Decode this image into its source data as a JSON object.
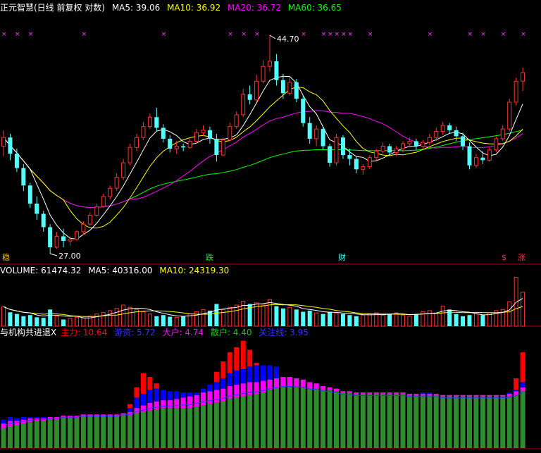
{
  "colors": {
    "background": "#000000",
    "up": "#ff3232",
    "down": "#54ffff",
    "ma5": "#ffffff",
    "ma10": "#ffff00",
    "ma20": "#ff00ff",
    "ma60": "#00ff00",
    "frame": "#b00000",
    "main_force": "#ff0000",
    "private_equity": "#0000ff",
    "big_holder": "#ff00ff",
    "retail": "#2e8b2e",
    "key_line": "#3333ff"
  },
  "price_panel": {
    "title": "正元智慧(日线 前复权 对数)",
    "ma5_label": "MA5: 39.06",
    "ma10_label": "MA10: 36.92",
    "ma20_label": "MA20: 36.72",
    "ma60_label": "MA60: 36.65",
    "high_label": "44.70",
    "low_label": "27.00",
    "signal_labels": [
      "稳",
      "跌",
      "财",
      "$",
      "涨"
    ]
  },
  "volume_panel": {
    "volume_label": "VOLUME: 61474.32",
    "ma5_label": "MA5: 40316.00",
    "ma10_label": "MA10: 24319.30"
  },
  "indicator_panel": {
    "title": "与机构共进退X",
    "main_force_label": "主力: 10.64",
    "private_equity_label": "游资: 5.72",
    "big_holder_label": "大户: 4.74",
    "retail_label": "散户: 4.40",
    "key_line_label": "关注线: 3.95"
  },
  "chart_data": {
    "type": "candlestick",
    "price_scale": "log",
    "price_range": [
      27.0,
      44.7
    ],
    "candles": [
      [
        34.6,
        35.9,
        33.8,
        35.3
      ],
      [
        35.3,
        35.6,
        33.5,
        34.0
      ],
      [
        34.0,
        34.4,
        32.6,
        32.9
      ],
      [
        32.9,
        33.2,
        31.2,
        31.6
      ],
      [
        31.6,
        31.8,
        30.0,
        30.3
      ],
      [
        30.3,
        30.8,
        29.2,
        29.6
      ],
      [
        29.6,
        29.8,
        28.4,
        28.7
      ],
      [
        28.7,
        28.9,
        27.0,
        27.4
      ],
      [
        27.4,
        28.4,
        27.3,
        28.1
      ],
      [
        28.1,
        28.6,
        27.4,
        27.8
      ],
      [
        27.8,
        28.1,
        27.5,
        27.9
      ],
      [
        27.9,
        28.5,
        27.8,
        28.4
      ],
      [
        28.4,
        29.1,
        28.2,
        28.9
      ],
      [
        28.9,
        29.7,
        28.8,
        29.5
      ],
      [
        29.5,
        30.3,
        29.4,
        30.1
      ],
      [
        30.1,
        31.0,
        30.0,
        30.8
      ],
      [
        30.8,
        31.6,
        30.6,
        31.4
      ],
      [
        31.4,
        32.5,
        31.2,
        32.2
      ],
      [
        32.2,
        33.6,
        32.0,
        33.3
      ],
      [
        33.3,
        34.8,
        33.1,
        34.5
      ],
      [
        34.5,
        35.6,
        34.2,
        35.3
      ],
      [
        35.3,
        36.6,
        35.1,
        36.2
      ],
      [
        36.2,
        37.3,
        36.0,
        37.0
      ],
      [
        37.0,
        37.8,
        35.8,
        36.1
      ],
      [
        36.1,
        36.4,
        34.9,
        35.2
      ],
      [
        35.2,
        35.5,
        34.1,
        34.4
      ],
      [
        34.4,
        35.0,
        34.0,
        34.6
      ],
      [
        34.6,
        34.8,
        34.2,
        34.5
      ],
      [
        34.5,
        35.2,
        34.4,
        35.0
      ],
      [
        35.0,
        36.0,
        34.8,
        35.7
      ],
      [
        35.7,
        36.3,
        35.4,
        35.9
      ],
      [
        35.9,
        36.2,
        34.8,
        35.2
      ],
      [
        35.2,
        35.6,
        33.4,
        33.9
      ],
      [
        33.9,
        35.3,
        33.8,
        35.1
      ],
      [
        35.1,
        36.5,
        35.0,
        36.2
      ],
      [
        36.2,
        37.5,
        36.0,
        37.2
      ],
      [
        37.2,
        39.5,
        37.0,
        39.0
      ],
      [
        39.0,
        39.8,
        38.1,
        38.5
      ],
      [
        38.5,
        40.8,
        38.3,
        40.2
      ],
      [
        40.2,
        42.2,
        40.0,
        41.6
      ],
      [
        41.6,
        44.7,
        41.1,
        42.1
      ],
      [
        42.1,
        42.8,
        39.8,
        40.3
      ],
      [
        40.3,
        40.9,
        38.6,
        39.1
      ],
      [
        39.1,
        40.6,
        38.9,
        40.1
      ],
      [
        40.1,
        40.4,
        38.3,
        38.6
      ],
      [
        38.6,
        38.9,
        36.2,
        36.5
      ],
      [
        36.5,
        37.0,
        34.8,
        35.2
      ],
      [
        35.2,
        36.3,
        34.6,
        36.0
      ],
      [
        36.0,
        36.2,
        34.3,
        34.6
      ],
      [
        34.6,
        34.8,
        33.0,
        33.3
      ],
      [
        33.3,
        35.6,
        33.1,
        35.3
      ],
      [
        35.3,
        35.5,
        33.6,
        33.9
      ],
      [
        33.9,
        34.4,
        33.1,
        33.6
      ],
      [
        33.6,
        33.8,
        32.5,
        32.8
      ],
      [
        32.8,
        33.2,
        32.4,
        33.0
      ],
      [
        33.0,
        33.9,
        32.8,
        33.7
      ],
      [
        33.7,
        34.4,
        33.5,
        34.2
      ],
      [
        34.2,
        34.9,
        34.0,
        34.6
      ],
      [
        34.6,
        34.8,
        33.9,
        34.1
      ],
      [
        34.1,
        34.6,
        33.8,
        34.4
      ],
      [
        34.4,
        35.0,
        34.1,
        34.8
      ],
      [
        34.8,
        35.3,
        34.5,
        35.0
      ],
      [
        35.0,
        35.2,
        34.3,
        34.6
      ],
      [
        34.6,
        35.1,
        34.4,
        34.9
      ],
      [
        34.9,
        35.6,
        34.7,
        35.3
      ],
      [
        35.3,
        36.1,
        35.0,
        35.8
      ],
      [
        35.8,
        36.6,
        35.5,
        36.3
      ],
      [
        36.3,
        36.5,
        35.6,
        35.9
      ],
      [
        35.9,
        36.2,
        35.0,
        35.4
      ],
      [
        35.4,
        35.7,
        34.3,
        34.6
      ],
      [
        34.6,
        34.9,
        32.8,
        33.1
      ],
      [
        33.1,
        34.0,
        32.9,
        33.7
      ],
      [
        33.7,
        34.2,
        33.2,
        33.5
      ],
      [
        33.5,
        34.5,
        33.4,
        34.3
      ],
      [
        34.3,
        35.4,
        34.1,
        35.2
      ],
      [
        35.2,
        36.3,
        35.0,
        36.0
      ],
      [
        36.0,
        38.6,
        35.8,
        38.3
      ],
      [
        38.3,
        40.5,
        38.0,
        40.2
      ],
      [
        40.2,
        41.5,
        39.3,
        41.0
      ]
    ],
    "volume": [
      35,
      25,
      22,
      18,
      20,
      16,
      15,
      30,
      18,
      12,
      14,
      16,
      15,
      18,
      22,
      25,
      28,
      32,
      38,
      34,
      30,
      26,
      22,
      18,
      20,
      17,
      16,
      18,
      22,
      26,
      30,
      28,
      40,
      30,
      34,
      38,
      45,
      40,
      42,
      38,
      48,
      36,
      32,
      34,
      30,
      26,
      28,
      24,
      22,
      26,
      24,
      22,
      20,
      18,
      20,
      22,
      24,
      20,
      22,
      24,
      20,
      18,
      22,
      26,
      28,
      24,
      36,
      30,
      22,
      18,
      20,
      22,
      20,
      24,
      28,
      30,
      44,
      88,
      61
    ],
    "volume_ma5": "computed",
    "volume_ma10": "computed",
    "indicator_series": [
      "主力",
      "游资",
      "大户",
      "散户",
      "关注线"
    ],
    "indicator": {
      "retail": [
        1.5,
        1.7,
        1.8,
        1.9,
        2.0,
        2.1,
        2.1,
        2.2,
        2.2,
        2.3,
        2.3,
        2.3,
        2.4,
        2.4,
        2.4,
        2.4,
        2.4,
        2.4,
        2.5,
        2.5,
        2.7,
        2.8,
        2.9,
        3.0,
        3.1,
        3.1,
        3.1,
        3.1,
        3.1,
        3.2,
        3.3,
        3.4,
        3.5,
        3.6,
        3.8,
        3.9,
        4.0,
        4.1,
        4.2,
        4.3,
        4.5,
        4.6,
        4.7,
        4.7,
        4.7,
        4.7,
        4.6,
        4.6,
        4.5,
        4.5,
        4.4,
        4.3,
        4.3,
        4.2,
        4.2,
        4.2,
        4.2,
        4.2,
        4.2,
        4.2,
        4.2,
        4.1,
        4.1,
        4.1,
        4.1,
        4.1,
        4.0,
        4.0,
        4.0,
        4.0,
        4.0,
        4.0,
        4.0,
        4.0,
        4.0,
        4.0,
        4.0,
        4.1,
        4.4
      ],
      "big": [
        0.4,
        0.4,
        0.3,
        0.3,
        0.3,
        0.2,
        0.2,
        0.2,
        0.2,
        0.2,
        0.2,
        0.2,
        0.2,
        0.2,
        0.2,
        0.2,
        0.2,
        0.2,
        0.2,
        0.3,
        0.4,
        0.5,
        0.6,
        0.6,
        0.6,
        0.6,
        0.7,
        0.8,
        0.9,
        0.9,
        1.0,
        1.0,
        1.0,
        1.0,
        1.0,
        1.0,
        1.0,
        1.0,
        0.9,
        0.9,
        0.8,
        0.8,
        0.8,
        0.8,
        0.7,
        0.6,
        0.5,
        0.4,
        0.3,
        0.2,
        0.2,
        0.1,
        0.1,
        0.1,
        0.1,
        0.1,
        0.1,
        0.1,
        0.1,
        0.1,
        0.1,
        0.1,
        0.1,
        0.1,
        0.1,
        0.1,
        0.1,
        0.1,
        0.1,
        0.1,
        0.1,
        0.1,
        0.1,
        0.1,
        0.1,
        0.1,
        0.2,
        0.3,
        0.3
      ],
      "pe": [
        0.3,
        0.3,
        0.2,
        0.2,
        0.1,
        0.1,
        0.1,
        0.0,
        0.0,
        0.0,
        0.0,
        0.0,
        0.0,
        0.0,
        0.0,
        0.0,
        0.0,
        0.0,
        0.0,
        0.3,
        0.8,
        0.9,
        1.0,
        1.0,
        0.8,
        0.7,
        0.6,
        0.4,
        0.3,
        0.2,
        0.3,
        0.5,
        0.6,
        0.8,
        1.0,
        1.1,
        1.1,
        1.2,
        1.3,
        1.2,
        1.1,
        0.9,
        0.0,
        0.0,
        0.0,
        0.0,
        0.0,
        0.0,
        0.0,
        0.0,
        0.0,
        0.0,
        0.0,
        0.0,
        0.0,
        0.0,
        0.0,
        0.0,
        0.0,
        0.0,
        0.0,
        0.0,
        0.0,
        0.1,
        0.1,
        0.0,
        0.0,
        0.0,
        0.0,
        0.0,
        0.0,
        0.0,
        0.0,
        0.0,
        0.0,
        0.0,
        0.1,
        0.1,
        0.4
      ],
      "main": [
        0,
        0,
        0,
        0,
        0,
        0,
        0,
        0,
        0,
        0,
        0,
        0,
        0,
        0,
        0,
        0,
        0,
        0,
        0,
        0.3,
        0.8,
        1.6,
        1.0,
        0.4,
        0.0,
        0.0,
        0.0,
        0.0,
        0,
        0,
        0,
        0,
        0.8,
        1.3,
        1.6,
        1.8,
        2.2,
        1.3,
        0.2,
        0.0,
        0,
        0,
        0,
        0,
        0,
        0,
        0,
        0,
        0,
        0,
        0,
        0,
        0,
        0,
        0,
        0,
        0,
        0,
        0,
        0,
        0,
        0,
        0,
        0,
        0,
        0,
        0,
        0,
        0,
        0,
        0,
        0,
        0,
        0,
        0,
        0,
        0,
        0.9,
        2.3
      ],
      "key_line": "computed"
    }
  }
}
